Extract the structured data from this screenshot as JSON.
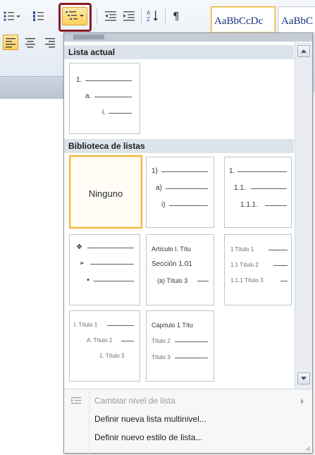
{
  "ribbon": {
    "style_1": "AaBbCcDc",
    "style_2": "AaBbC"
  },
  "dropdown": {
    "current_list_header": "Lista actual",
    "current_list_tile": {
      "level1": "1.",
      "level2": "a.",
      "level3": "i."
    },
    "library_header": "Biblioteca de listas",
    "library": [
      {
        "id": "ninguno",
        "label": "Ninguno",
        "selected": true
      },
      {
        "id": "parens",
        "levels": [
          "1)",
          "a)",
          "i)"
        ]
      },
      {
        "id": "decimal",
        "levels": [
          "1.",
          "1.1.",
          "1.1.1."
        ]
      },
      {
        "id": "bullets",
        "levels": [
          "❖",
          "➢",
          "•"
        ]
      },
      {
        "id": "articulo",
        "levels": [
          "Artículo I. Títu",
          "Sección 1.01",
          "(a) Título 3"
        ]
      },
      {
        "id": "titulo-decimal",
        "levels": [
          "1 Título 1",
          "1.1 Título 2",
          "1.1.1 Título 3"
        ]
      },
      {
        "id": "titulo-roman",
        "levels": [
          "I. Título 1",
          "A. Título 2",
          "1. Título 3"
        ]
      },
      {
        "id": "capitulo",
        "levels": [
          "Capítulo 1 Títu",
          "Título 2",
          "Título 3"
        ]
      }
    ],
    "menu": {
      "change_level": "Cambiar nivel de lista",
      "define_multilevel": "Definir nueva lista multinivel...",
      "define_style": "Definir nuevo estilo de lista..."
    },
    "colors": {
      "selection_border": "#f0b43a",
      "highlight_frame": "#8a1a24",
      "header_bg": "#dde3eb"
    }
  }
}
